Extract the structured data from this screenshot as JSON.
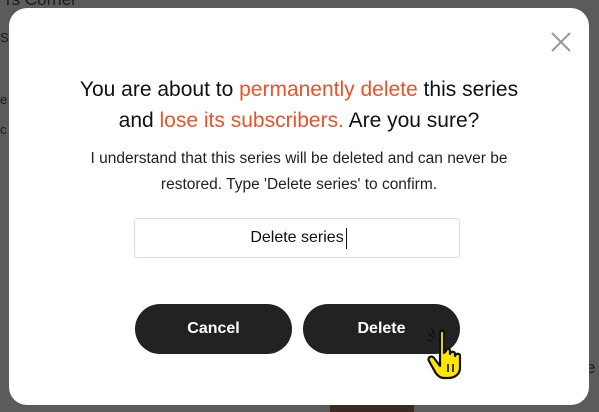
{
  "background": {
    "top_fragment": "rs Corner",
    "right_fragment": "e",
    "left_fragments": [
      "S",
      "e",
      "c"
    ]
  },
  "dialog": {
    "title_line1_prefix": "You are about to ",
    "title_line1_highlight": "permanently delete",
    "title_line1_suffix": " this series",
    "title_line2_prefix": "and ",
    "title_line2_highlight": "lose its subscribers.",
    "title_line2_suffix": " Are you sure?",
    "description_line1": "I understand that this series will be deleted and can never be",
    "description_line2": "restored. Type 'Delete series' to confirm.",
    "input_value": "Delete series",
    "cancel_label": "Cancel",
    "delete_label": "Delete",
    "close_icon": "close-icon",
    "cursor_icon": "pointing-hand-cursor-icon"
  },
  "colors": {
    "highlight": "#e8542a",
    "button": "#222222",
    "overlay": "#5b5b5b",
    "cursor": "#ffe600"
  }
}
